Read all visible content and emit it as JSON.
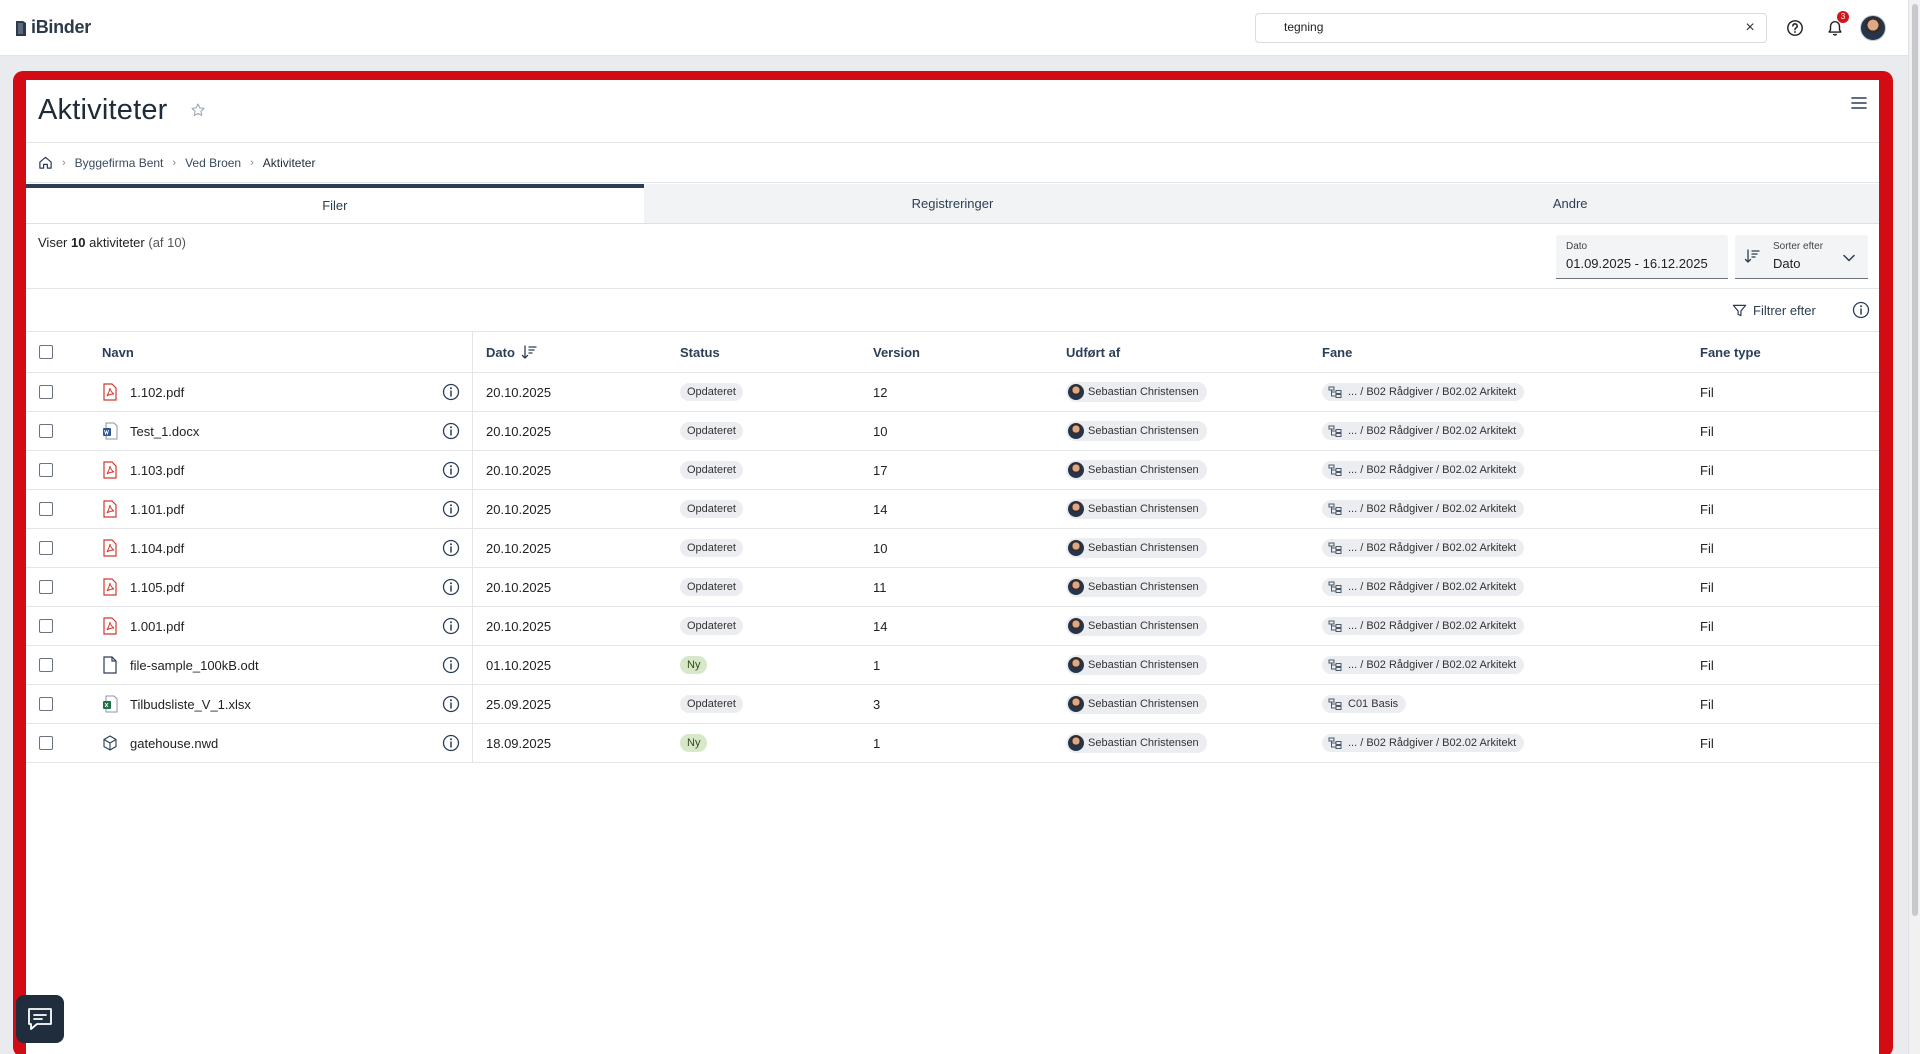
{
  "app": {
    "logo_text": "iBinder"
  },
  "header": {
    "search_value": "tegning",
    "clear_symbol": "×",
    "notification_count": "3"
  },
  "page": {
    "title": "Aktiviteter",
    "breadcrumb": [
      "Byggefirma Bent",
      "Ved Broen",
      "Aktiviteter"
    ],
    "tabs": [
      {
        "label": "Filer",
        "active": true
      },
      {
        "label": "Registreringer",
        "active": false
      },
      {
        "label": "Andre",
        "active": false
      }
    ]
  },
  "summary": {
    "prefix": "Viser",
    "count": "10",
    "noun": "aktiviteter",
    "total": "(af 10)"
  },
  "date_filter": {
    "label": "Dato",
    "value": "01.09.2025 - 16.12.2025"
  },
  "sort": {
    "label": "Sorter efter",
    "value": "Dato"
  },
  "filter": {
    "label": "Filtrer efter"
  },
  "table": {
    "columns": [
      "Navn",
      "Dato",
      "Status",
      "Version",
      "Udført af",
      "Fane",
      "Fane type"
    ],
    "rows": [
      {
        "name": "1.102.pdf",
        "icon": "pdf-file-icon",
        "date": "20.10.2025",
        "status": "Opdateret",
        "version": "12",
        "user": "Sebastian Christensen",
        "fane": "... / B02 Rådgiver / B02.02 Arkitekt",
        "fane_type": "Fil"
      },
      {
        "name": "Test_1.docx",
        "icon": "word-file-icon",
        "date": "20.10.2025",
        "status": "Opdateret",
        "version": "10",
        "user": "Sebastian Christensen",
        "fane": "... / B02 Rådgiver / B02.02 Arkitekt",
        "fane_type": "Fil"
      },
      {
        "name": "1.103.pdf",
        "icon": "pdf-file-icon",
        "date": "20.10.2025",
        "status": "Opdateret",
        "version": "17",
        "user": "Sebastian Christensen",
        "fane": "... / B02 Rådgiver / B02.02 Arkitekt",
        "fane_type": "Fil"
      },
      {
        "name": "1.101.pdf",
        "icon": "pdf-file-icon",
        "date": "20.10.2025",
        "status": "Opdateret",
        "version": "14",
        "user": "Sebastian Christensen",
        "fane": "... / B02 Rådgiver / B02.02 Arkitekt",
        "fane_type": "Fil"
      },
      {
        "name": "1.104.pdf",
        "icon": "pdf-file-icon",
        "date": "20.10.2025",
        "status": "Opdateret",
        "version": "10",
        "user": "Sebastian Christensen",
        "fane": "... / B02 Rådgiver / B02.02 Arkitekt",
        "fane_type": "Fil"
      },
      {
        "name": "1.105.pdf",
        "icon": "pdf-file-icon",
        "date": "20.10.2025",
        "status": "Opdateret",
        "version": "11",
        "user": "Sebastian Christensen",
        "fane": "... / B02 Rådgiver / B02.02 Arkitekt",
        "fane_type": "Fil"
      },
      {
        "name": "1.001.pdf",
        "icon": "pdf-file-icon",
        "date": "20.10.2025",
        "status": "Opdateret",
        "version": "14",
        "user": "Sebastian Christensen",
        "fane": "... / B02 Rådgiver / B02.02 Arkitekt",
        "fane_type": "Fil"
      },
      {
        "name": "file-sample_100kB.odt",
        "icon": "generic-file-icon",
        "date": "01.10.2025",
        "status": "Ny",
        "version": "1",
        "user": "Sebastian Christensen",
        "fane": "... / B02 Rådgiver / B02.02 Arkitekt",
        "fane_type": "Fil"
      },
      {
        "name": "Tilbudsliste_V_1.xlsx",
        "icon": "excel-file-icon",
        "date": "25.09.2025",
        "status": "Opdateret",
        "version": "3",
        "user": "Sebastian Christensen",
        "fane": "C01 Basis",
        "fane_type": "Fil"
      },
      {
        "name": "gatehouse.nwd",
        "icon": "model-file-icon",
        "date": "18.09.2025",
        "status": "Ny",
        "version": "1",
        "user": "Sebastian Christensen",
        "fane": "... / B02 Rådgiver / B02.02 Arkitekt",
        "fane_type": "Fil"
      }
    ]
  },
  "colors": {
    "frame_accent": "#d30b15",
    "tab_active_bar": "#2c3e57",
    "status_new_bg": "#d7e7c8",
    "chat_button_bg": "#1f2d3d"
  }
}
